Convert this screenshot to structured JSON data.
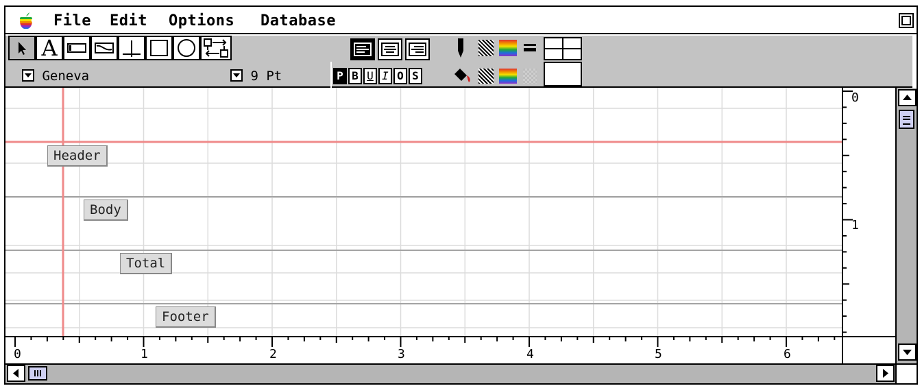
{
  "menubar": {
    "items": [
      "File",
      "Edit",
      "Options",
      "Database"
    ]
  },
  "toolbar": {
    "tools": [
      "pointer-tool",
      "text-tool",
      "field-tool",
      "graphic-field-tool",
      "line-tool",
      "rectangle-tool",
      "oval-tool",
      "flow-tool"
    ],
    "text_tool_glyph": "A",
    "font": "Geneva",
    "size": "9 Pt",
    "styles": [
      "P",
      "B",
      "U",
      "I",
      "O",
      "S"
    ]
  },
  "layout": {
    "sections": [
      "Header",
      "Body",
      "Total",
      "Footer"
    ]
  },
  "rulers": {
    "horizontal": [
      "0",
      "1",
      "2",
      "3",
      "4",
      "5",
      "6"
    ],
    "vertical": [
      "0",
      "1"
    ]
  },
  "colors": {
    "margin_line": "#ef8a8a",
    "section_line": "#a3a3a3",
    "grid": "#dcdcdc",
    "chrome": "#c3c3c3",
    "thumb": "#cfd0f2"
  }
}
